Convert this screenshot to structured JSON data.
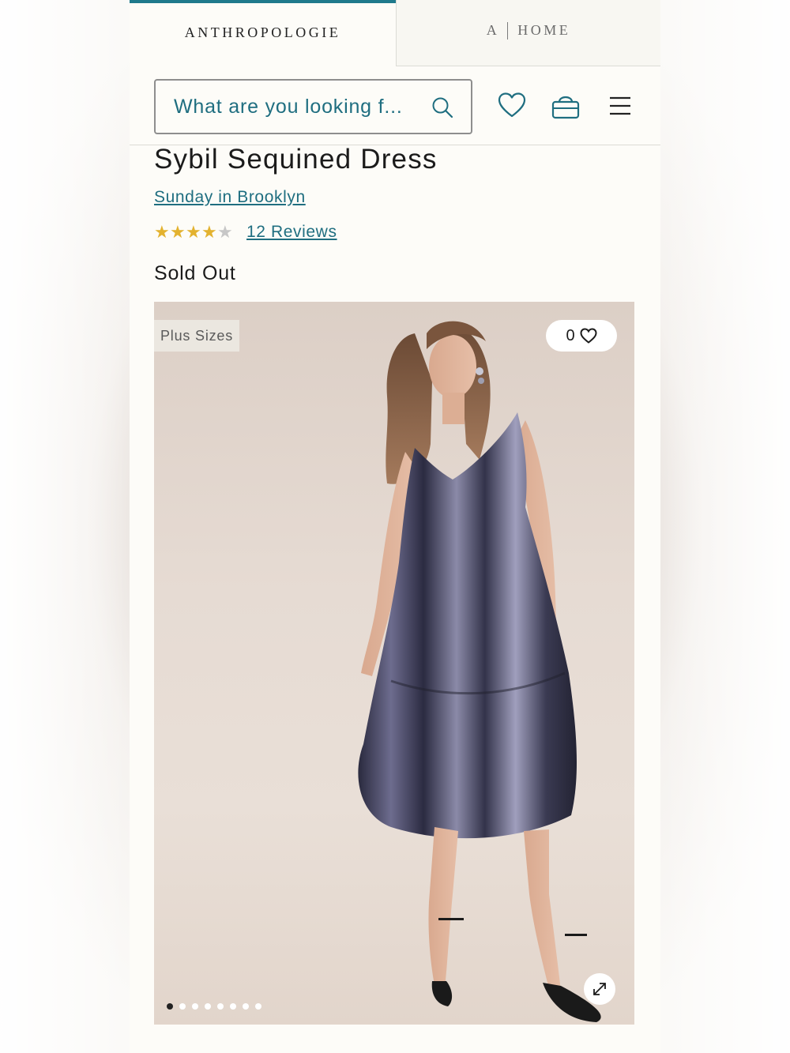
{
  "brand_tabs": {
    "main_label": "ANTHROPOLOGIE",
    "home_label_a": "A",
    "home_label": "HOME"
  },
  "search": {
    "placeholder": "What are you looking f...",
    "value": ""
  },
  "header_icons": [
    "heart-icon",
    "shopping-bag-icon",
    "hamburger-menu-icon"
  ],
  "product": {
    "title": "Sybil Sequined Dress",
    "brand": "Sunday in Brooklyn",
    "rating": 4,
    "rating_max": 5,
    "reviews_label": "12 Reviews",
    "status": "Sold Out"
  },
  "gallery": {
    "badge": "Plus Sizes",
    "favorites_count": "0",
    "image_count": 8,
    "active_index": 0
  },
  "colors": {
    "accent": "#1f7a8c",
    "link": "#1f6e80",
    "star": "#e3b22f",
    "background": "#fdfcf8"
  }
}
